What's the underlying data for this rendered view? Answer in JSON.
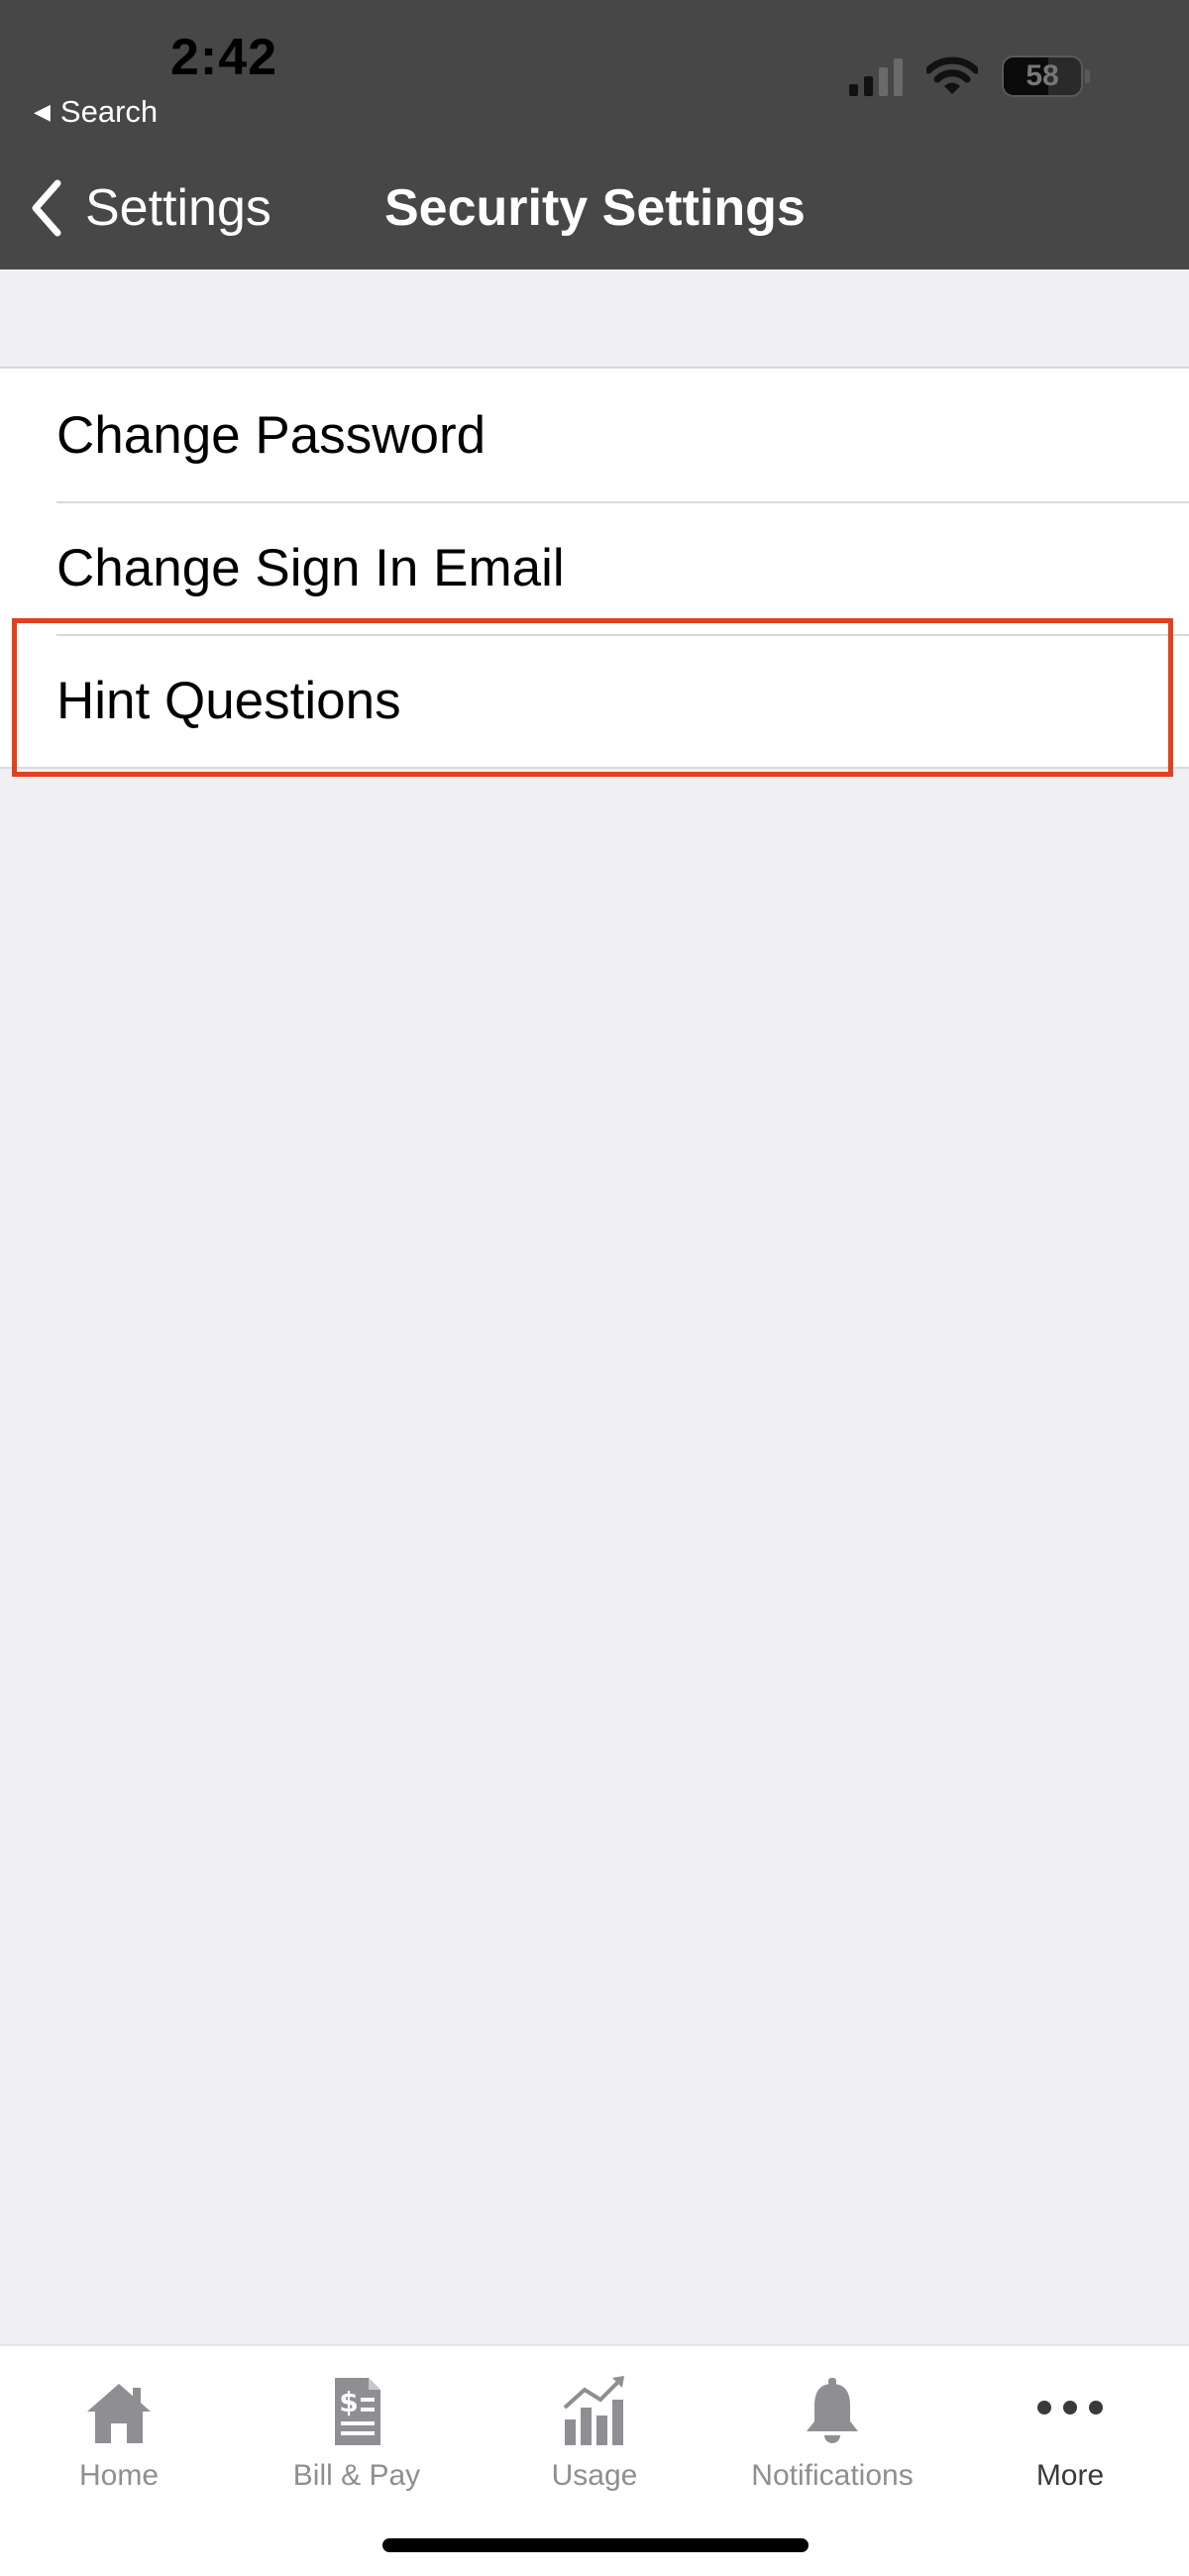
{
  "status_bar": {
    "time": "2:42",
    "back_app": "Search",
    "battery_percent": "58",
    "battery_level": 0.58
  },
  "nav": {
    "back_label": "Settings",
    "title": "Security Settings"
  },
  "settings_list": {
    "items": [
      {
        "label": "Change Password"
      },
      {
        "label": "Change Sign In Email"
      },
      {
        "label": "Hint Questions"
      }
    ],
    "highlighted": "Hint Questions",
    "highlight_color": "#e0411f"
  },
  "tab_bar": {
    "tabs": [
      {
        "label": "Home",
        "icon": "home-icon"
      },
      {
        "label": "Bill & Pay",
        "icon": "bill-icon"
      },
      {
        "label": "Usage",
        "icon": "usage-chart-icon"
      },
      {
        "label": "Notifications",
        "icon": "bell-icon"
      },
      {
        "label": "More",
        "icon": "more-dots-icon"
      }
    ],
    "active": "More"
  },
  "colors": {
    "header_bg": "#474747",
    "page_bg": "#f0eff4",
    "tab_inactive": "#8e8e93",
    "tab_active": "#3a3a3c"
  }
}
